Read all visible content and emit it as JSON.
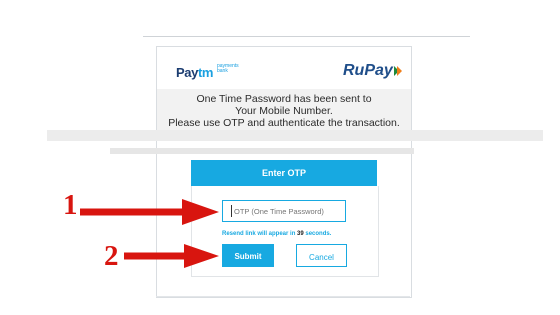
{
  "brand": {
    "paytm_pay": "Pay",
    "paytm_tm": "tm",
    "paytm_subtitle_line1": "payments",
    "paytm_subtitle_line2": "bank",
    "rupay": "RuPay"
  },
  "message": {
    "line1": "One Time Password has been sent to",
    "line2": "Your Mobile Number.",
    "line3": "Please use OTP and authenticate the transaction."
  },
  "otp": {
    "header": "Enter OTP",
    "input_placeholder": "OTP (One Time Password)",
    "input_value": "",
    "resend_prefix": "Resend link will appear in ",
    "resend_seconds": "39",
    "resend_suffix": " seconds."
  },
  "buttons": {
    "submit": "Submit",
    "cancel": "Cancel"
  },
  "annotations": {
    "marker1": "1",
    "marker2": "2",
    "arrow_color": "#d8150f"
  },
  "colors": {
    "accent": "#17a9e1",
    "paytm_dark": "#1b3c70",
    "rupay_blue": "#1f4e8a"
  }
}
